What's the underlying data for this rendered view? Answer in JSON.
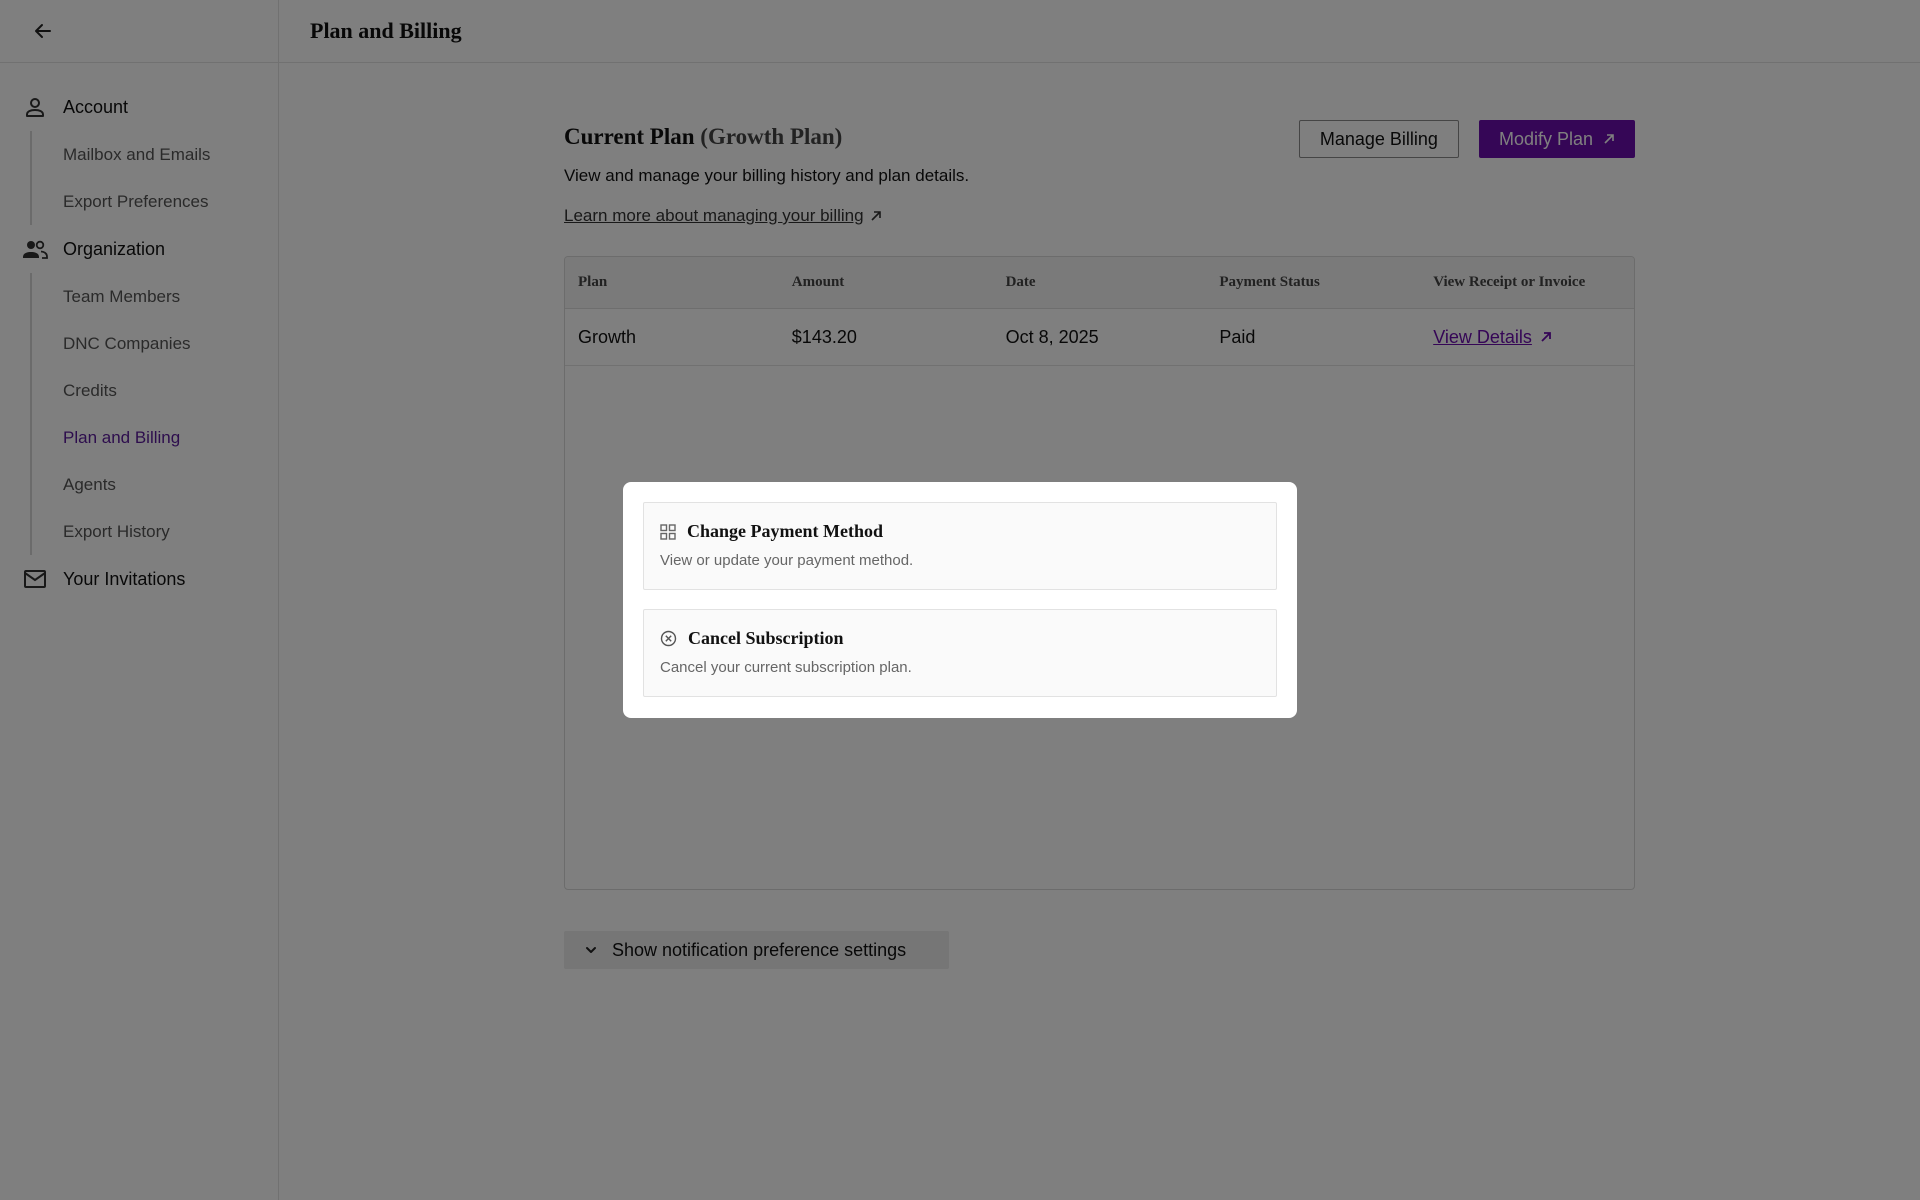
{
  "header": {
    "title": "Plan and Billing"
  },
  "sidebar": {
    "groups": [
      {
        "label": "Account",
        "icon": "person-icon"
      },
      {
        "label": "Organization",
        "icon": "people-icon"
      },
      {
        "label": "Your Invitations",
        "icon": "mail-icon"
      }
    ],
    "account_items": [
      "Mailbox and Emails",
      "Export Preferences"
    ],
    "organization_items": [
      "Team Members",
      "DNC Companies",
      "Credits",
      "Plan and Billing",
      "Agents",
      "Export History"
    ],
    "active_item": "Plan and Billing"
  },
  "main": {
    "title": "Current Plan",
    "title_sub": "(Growth Plan)",
    "description": "View and manage your billing history and plan details.",
    "learn_link": "Learn more about managing your billing",
    "manage_billing_label": "Manage Billing",
    "modify_plan_label": "Modify Plan",
    "notif_label": "Show notification preference settings"
  },
  "table": {
    "columns": [
      "Plan",
      "Amount",
      "Date",
      "Payment Status",
      "View Receipt or Invoice"
    ],
    "rows": [
      {
        "plan": "Growth",
        "amount": "$143.20",
        "date": "Oct 8, 2025",
        "status": "Paid",
        "link": "View Details"
      }
    ]
  },
  "modal": {
    "options": [
      {
        "title": "Change Payment Method",
        "desc": "View or update your payment method.",
        "icon": "grid-icon"
      },
      {
        "title": "Cancel Subscription",
        "desc": "Cancel your current subscription plan.",
        "icon": "cancel-circle-icon"
      }
    ]
  },
  "colors": {
    "accent": "#6a0dad",
    "overlay": "rgba(0,0,0,0.5)"
  }
}
